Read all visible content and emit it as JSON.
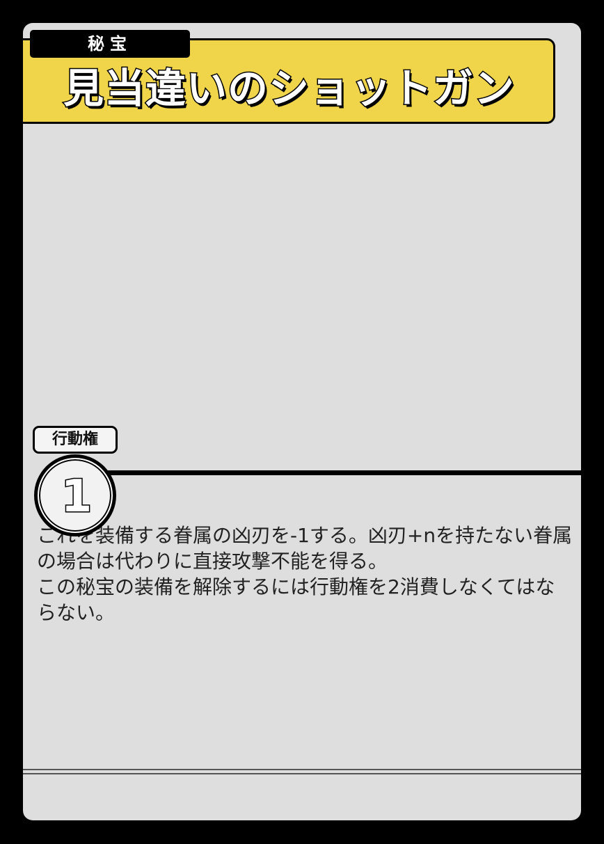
{
  "card": {
    "category": "秘宝",
    "title": "見当違いのショットガン",
    "cost_label": "行動権",
    "cost_value": "1",
    "effect": [
      "これを装備する眷属の凶刃を-1する。凶刃+nを持たない眷属の場合は代わりに直接攻撃不能を得る。",
      "この秘宝の装備を解除するには行動権を2消費しなくてはならない。"
    ]
  },
  "colors": {
    "background": "#000000",
    "card_body": "#dedede",
    "title_band": "#f0d44a"
  }
}
